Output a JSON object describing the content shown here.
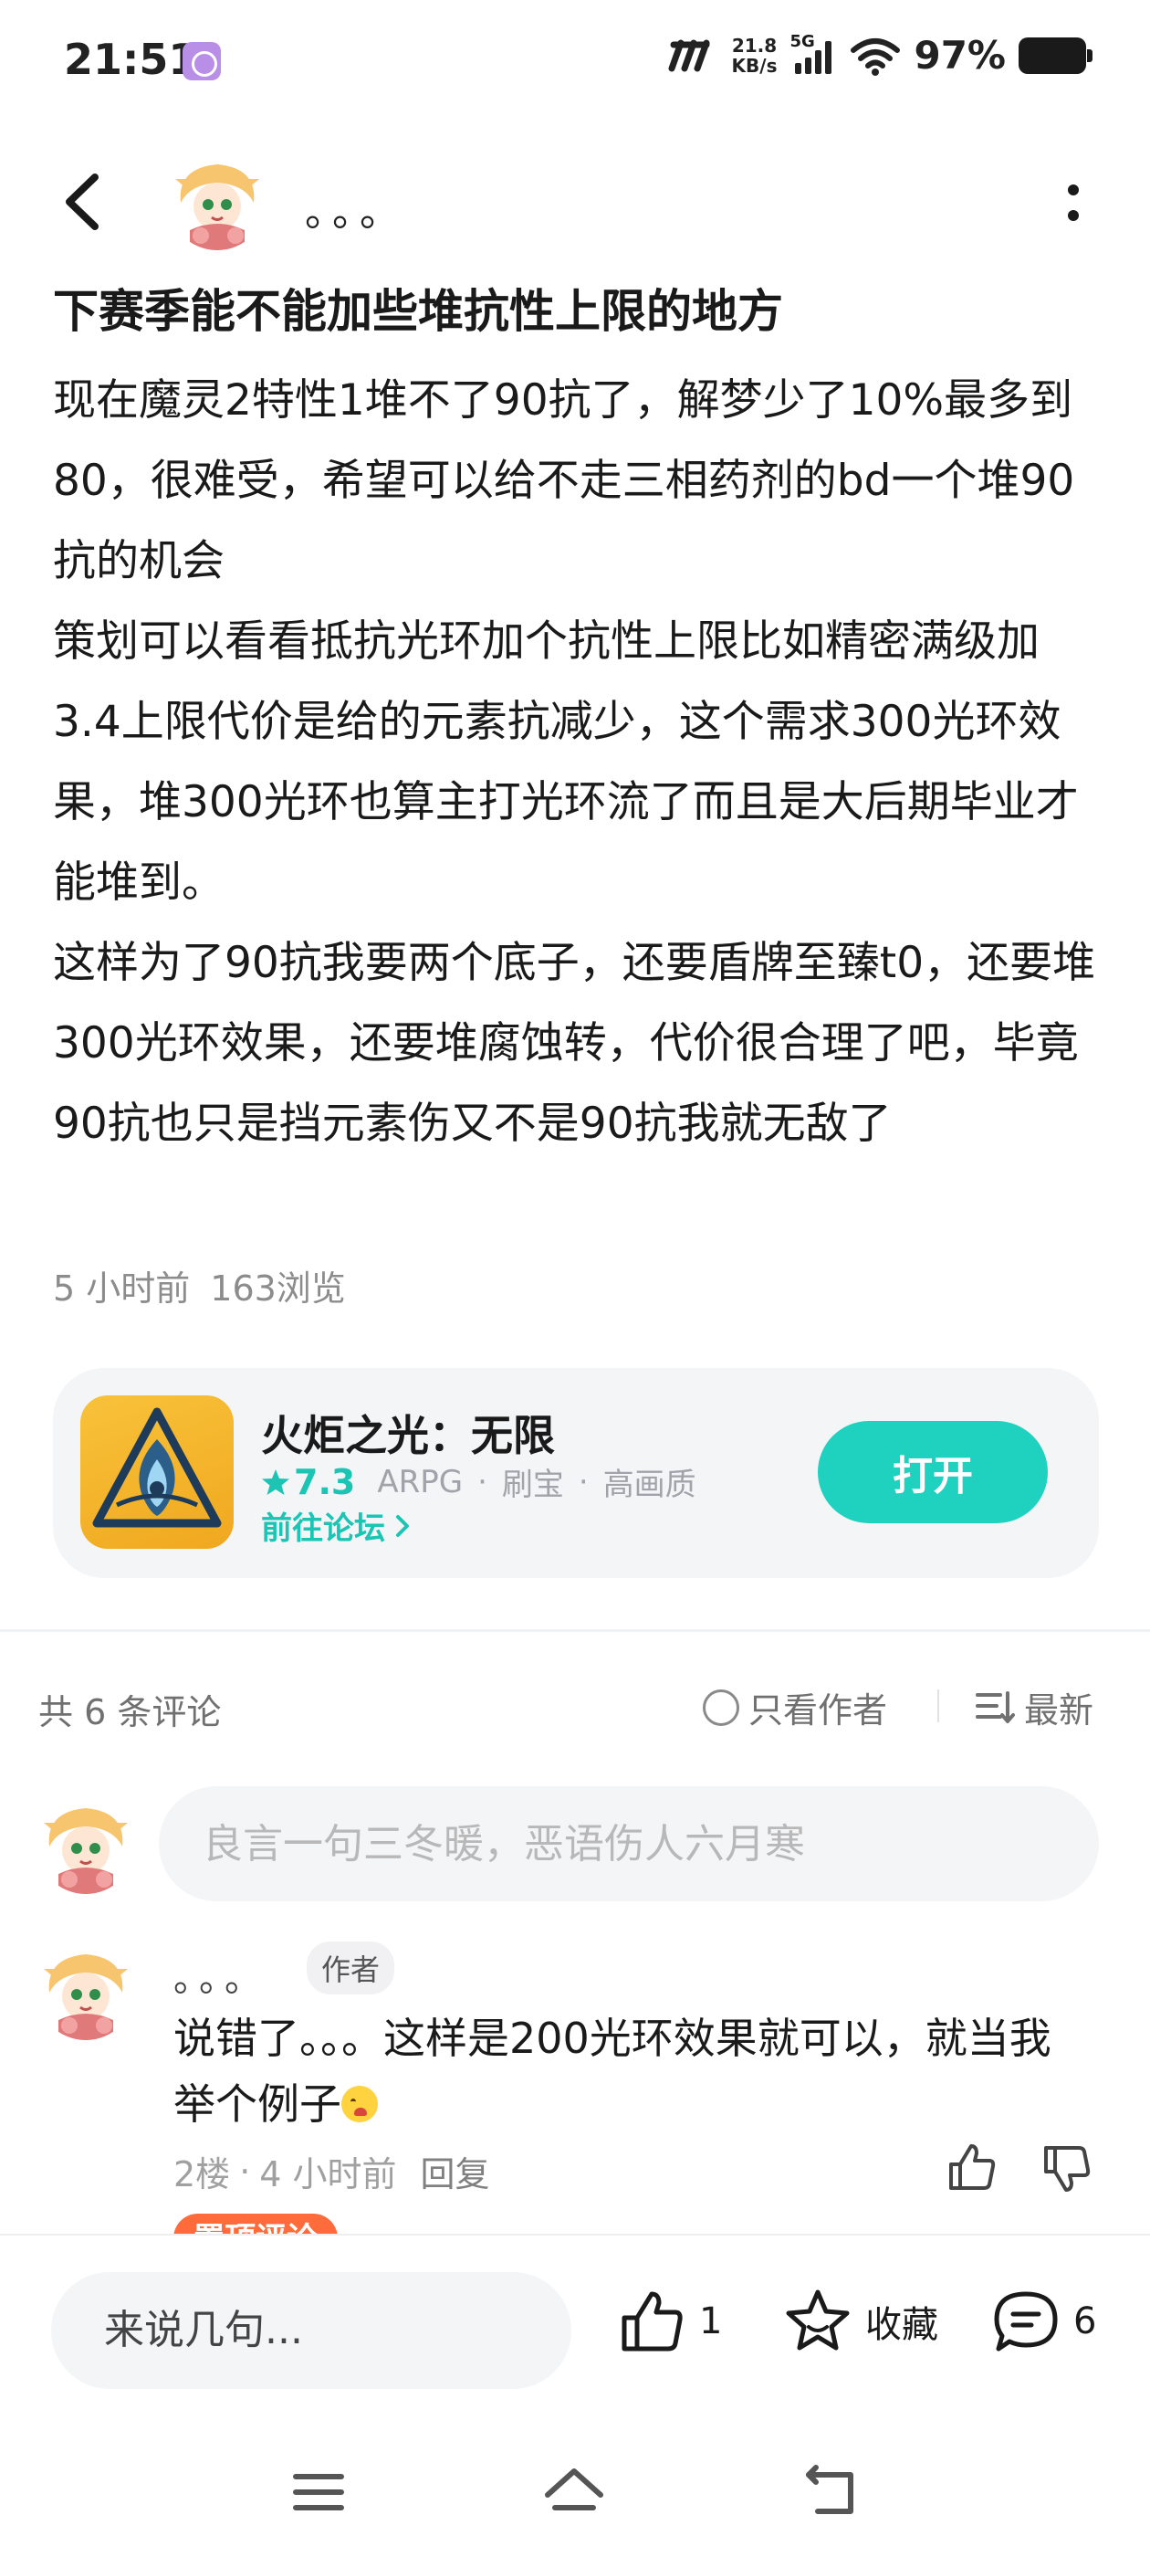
{
  "status_bar": {
    "time": "21:51",
    "net_speed_value": "21.8",
    "net_speed_unit": "KB/s",
    "network": "5G",
    "battery": "97%"
  },
  "header": {
    "author_name": "。。。",
    "back_icon": "chevron-left-icon",
    "more_icon": "vertical-dots-icon"
  },
  "post": {
    "title": "下赛季能不能加些堆抗性上限的地方",
    "body": "现在魔灵2特性1堆不了90抗了，解梦少了10%最多到80，很难受，希望可以给不走三相药剂的bd一个堆90抗的机会\n策划可以看看抵抗光环加个抗性上限比如精密满级加3.4上限代价是给的元素抗减少，这个需求300光环效果，堆300光环也算主打光环流了而且是大后期毕业才能堆到。\n这样为了90抗我要两个底子，还要盾牌至臻t0，还要堆300光环效果，还要堆腐蚀转，代价很合理了吧，毕竟90抗也只是挡元素伤又不是90抗我就无敌了",
    "time_ago": "5 小时前",
    "views": "163浏览"
  },
  "game_card": {
    "name": "火炬之光：无限",
    "rating": "7.3",
    "tags": [
      "ARPG",
      "刷宝",
      "高画质"
    ],
    "forum_link": "前往论坛",
    "open_button": "打开",
    "accent_color": "#1fd1bf"
  },
  "comments_header": {
    "count_label": "共 6 条评论",
    "only_author": "只看作者",
    "sort": "最新"
  },
  "comment_input": {
    "placeholder": "良言一句三冬暖，恶语伤人六月寒"
  },
  "comments": [
    {
      "name": "。。。",
      "badge": "作者",
      "text": "说错了。。。这样是200光环效果就可以，就当我举个例子",
      "emoji": "crying-face-emoji",
      "floor": "2楼",
      "time": "4 小时前",
      "reply": "回复"
    }
  ],
  "pinned_badge": "置顶评论",
  "bottom_bar": {
    "input_placeholder": "来说几句...",
    "like_count": "1",
    "favorite_label": "收藏",
    "comment_count": "6"
  }
}
